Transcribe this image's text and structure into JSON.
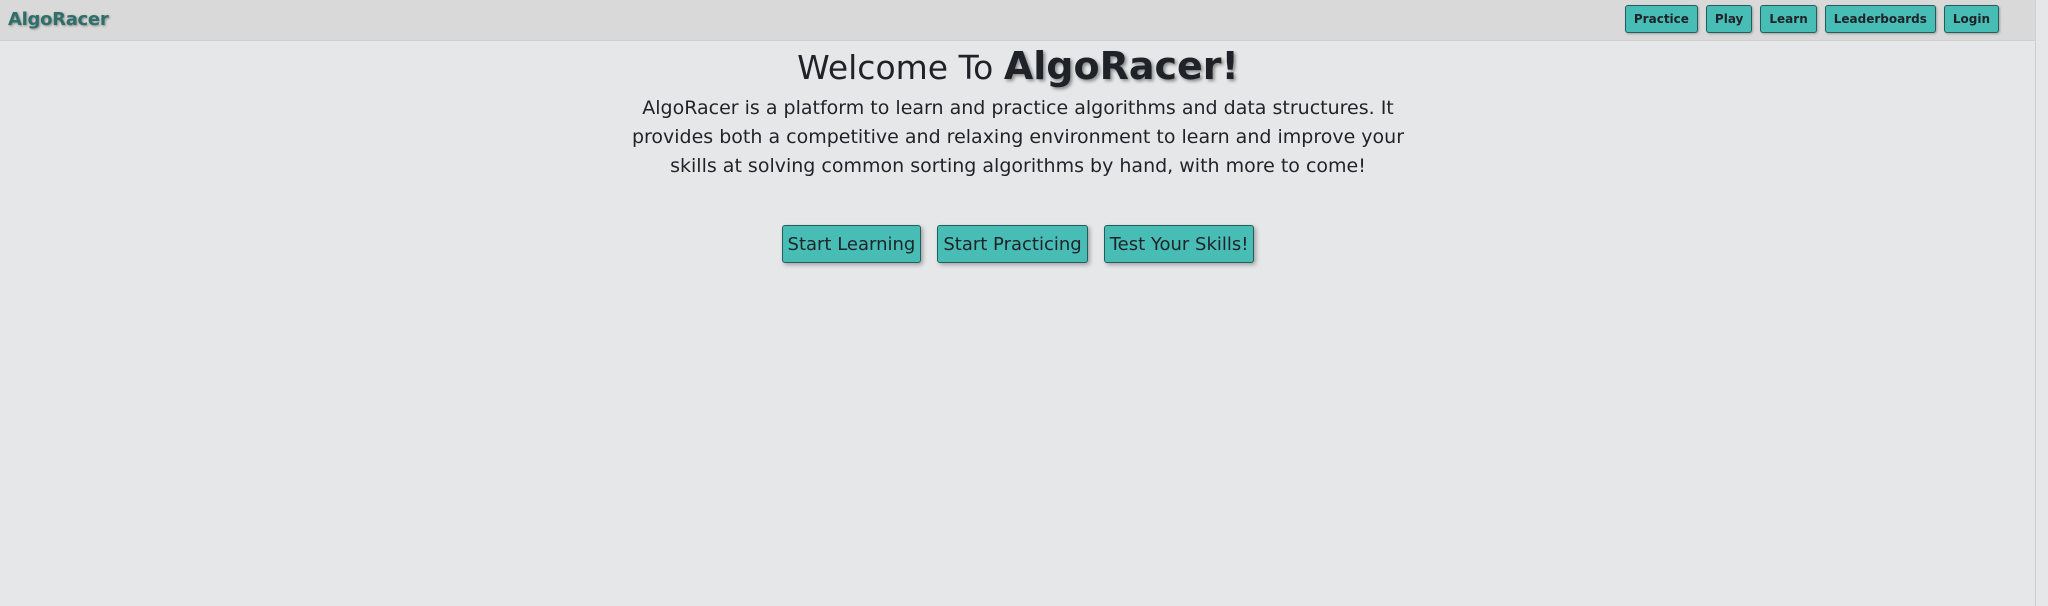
{
  "header": {
    "brand": "AlgoRacer",
    "nav": [
      "Practice",
      "Play",
      "Learn",
      "Leaderboards",
      "Login"
    ]
  },
  "hero": {
    "title_prefix": "Welcome To",
    "title_brand": "AlgoRacer!",
    "description": "AlgoRacer is a platform to learn and practice algorithms and data structures. It provides both a competitive and relaxing environment to learn and improve your skills at solving common sorting algorithms by hand, with more to come!",
    "actions": [
      "Start Learning",
      "Start Practicing",
      "Test Your Skills!"
    ]
  },
  "colors": {
    "background": "#e6e7e9",
    "navbar": "#d9d9d9",
    "accent": "#48bdb6",
    "brand_text": "#2f6f6a"
  }
}
